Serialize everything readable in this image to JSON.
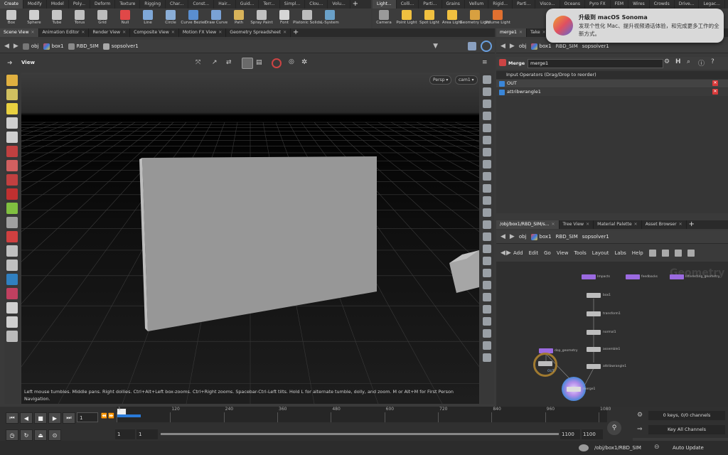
{
  "shelf_tabs_left": [
    "Create",
    "Modify",
    "Model",
    "Poly...",
    "Deform",
    "Texture",
    "Rigging",
    "Char...",
    "Const...",
    "Hair...",
    "Guid...",
    "Terr...",
    "Simpl...",
    "Clou...",
    "Volu..."
  ],
  "shelf_tabs_right": [
    "Light...",
    "Colli...",
    "Parti...",
    "Grains",
    "Vellum",
    "Rigid...",
    "Parti...",
    "Visco...",
    "Oceans",
    "Pyro FX",
    "FEM",
    "Wires",
    "Crowds",
    "Drive...",
    "Legac..."
  ],
  "tools_left": [
    {
      "label": "Box",
      "icon": "box-icon",
      "color": "#c9c9c9"
    },
    {
      "label": "Sphere",
      "icon": "sphere-icon",
      "color": "#d0d0d0"
    },
    {
      "label": "Tube",
      "icon": "tube-icon",
      "color": "#c6c6c6"
    },
    {
      "label": "Torus",
      "icon": "torus-icon",
      "color": "#c0c0c0"
    },
    {
      "label": "Grid",
      "icon": "grid-icon",
      "color": "#bdbdbd"
    },
    {
      "label": "Null",
      "icon": "null-icon",
      "color": "#e04848"
    },
    {
      "label": "Line",
      "icon": "line-icon",
      "color": "#7fa8d8"
    },
    {
      "label": "Circle",
      "icon": "circle-icon",
      "color": "#8aaed8"
    },
    {
      "label": "Curve Bezier",
      "icon": "curve-bezier-icon",
      "color": "#5a8ed0"
    },
    {
      "label": "Draw Curve",
      "icon": "draw-curve-icon",
      "color": "#7aa2d6"
    },
    {
      "label": "Path",
      "icon": "path-icon",
      "color": "#d8b35a"
    },
    {
      "label": "Spray Paint",
      "icon": "spray-paint-icon",
      "color": "#c0c0c0"
    },
    {
      "label": "Font",
      "icon": "font-icon",
      "color": "#d6d6d6"
    },
    {
      "label": "Platonic Solids",
      "icon": "platonic-solids-icon",
      "color": "#bcbcbc"
    },
    {
      "label": "L-System",
      "icon": "l-system-icon",
      "color": "#6aa0c8"
    }
  ],
  "tools_right": [
    {
      "label": "Camera",
      "icon": "camera-icon",
      "color": "#9a9a9a"
    },
    {
      "label": "Point Light",
      "icon": "point-light-icon",
      "color": "#f0c040"
    },
    {
      "label": "Spot Light",
      "icon": "spot-light-icon",
      "color": "#f0c040"
    },
    {
      "label": "Area Light",
      "icon": "area-light-icon",
      "color": "#f0c040"
    },
    {
      "label": "Geometry Light",
      "icon": "geometry-light-icon",
      "color": "#d8a040"
    },
    {
      "label": "Volume Light",
      "icon": "volume-light-icon",
      "color": "#e07030"
    }
  ],
  "viewer_tabs": [
    "Scene View",
    "Animation Editor",
    "Render View",
    "Composite View",
    "Motion FX View",
    "Geometry Spreadsheet"
  ],
  "param_tabs": [
    "merge1",
    "Take"
  ],
  "network_tabs": [
    "/obj/box1/RBD_SIM/s...",
    "Tree View",
    "Material Palette",
    "Asset Browser"
  ],
  "path": {
    "obj": "obj",
    "box": "box1",
    "sim": "RBD_SIM",
    "solver": "sopsolver1"
  },
  "viewport": {
    "title": "View",
    "persp": "Persp",
    "cam": "cam1",
    "hint": "Left mouse tumbles. Middle pans. Right dollies. Ctrl+Alt+Left box-zooms. Ctrl+Right zooms. Spacebar-Ctrl-Left tilts. Hold L for alternate tumble, dolly, and zoom.     M or Alt+M for First Person Navigation."
  },
  "param": {
    "type": "Merge",
    "name": "merge1",
    "section": "Input Operators (Drag/Drop to reorder)",
    "inputs": [
      "OUT",
      "attribwrangle1"
    ]
  },
  "network": {
    "menu": [
      "Add",
      "Edit",
      "Go",
      "View",
      "Tools",
      "Layout",
      "Labs",
      "Help"
    ],
    "watermark": "Geometry",
    "top_nodes": [
      "Impacts",
      "feedbacks",
      "Interesting_geometry"
    ],
    "chain": [
      "box1",
      "transform1",
      "normal1",
      "assemble1",
      "attribwrangle1"
    ],
    "sop_geometry": "dop_geometry",
    "merge": "merge1",
    "object_label": "OUT"
  },
  "timeline": {
    "ticks": [
      "1",
      "120",
      "240",
      "360",
      "480",
      "600",
      "720",
      "840",
      "960",
      "1080"
    ],
    "frame": "1",
    "start": "1",
    "start2": "1",
    "end": "1100",
    "end2": "1100",
    "keys": "0 keys, 0/0 channels",
    "key_all": "Key All Channels"
  },
  "status": {
    "path": "/obj/box1/RBD_SIM",
    "auto_update": "Auto Update"
  },
  "notification": {
    "title": "升级到 macOS Sonoma",
    "body": "发现个性化 Mac、提升视频通话体验，和完成更多工作的全新方式。"
  },
  "colors": {
    "node_purple": "#9b6ae0",
    "merge_blue": "#4aa0e0",
    "error_red": "#d83a3a"
  }
}
